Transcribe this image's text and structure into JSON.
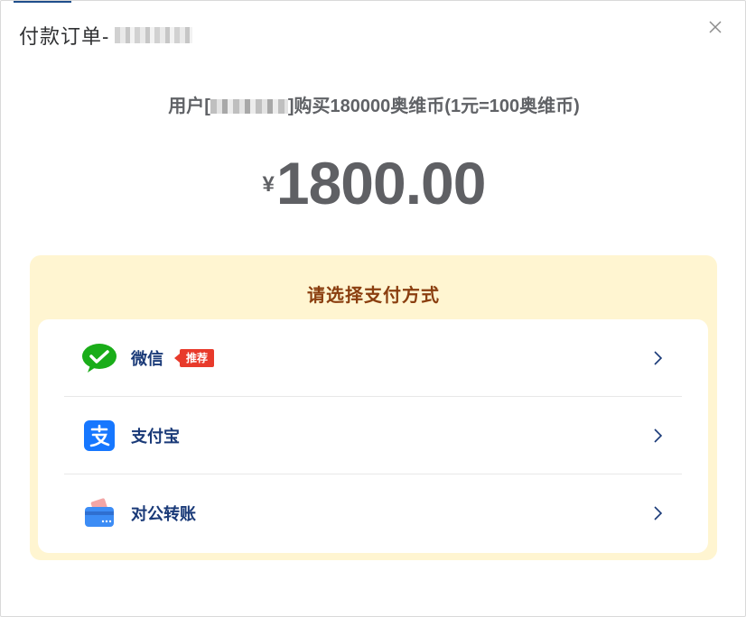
{
  "dialog": {
    "title": "付款订单-",
    "order_no_masked": "███████",
    "close_icon": "close-icon"
  },
  "purchase": {
    "prefix": "用户[",
    "user_masked": "██████",
    "suffix": "]购买180000奥维币(1元=100奥维币)"
  },
  "price": {
    "currency": "¥",
    "amount": "1800.00"
  },
  "payment": {
    "title": "请选择支付方式",
    "methods": [
      {
        "label": "微信",
        "badge": "推荐",
        "icon": "wechat-icon"
      },
      {
        "label": "支付宝",
        "icon": "alipay-icon"
      },
      {
        "label": "对公转账",
        "icon": "bank-card-icon"
      }
    ]
  },
  "colors": {
    "panel_bg": "#fff5d1",
    "title_brown": "#8a3e0f",
    "method_blue": "#1a3a78",
    "badge_red": "#e83a2b",
    "wechat_green": "#1aad19",
    "alipay_blue": "#1677ff"
  }
}
